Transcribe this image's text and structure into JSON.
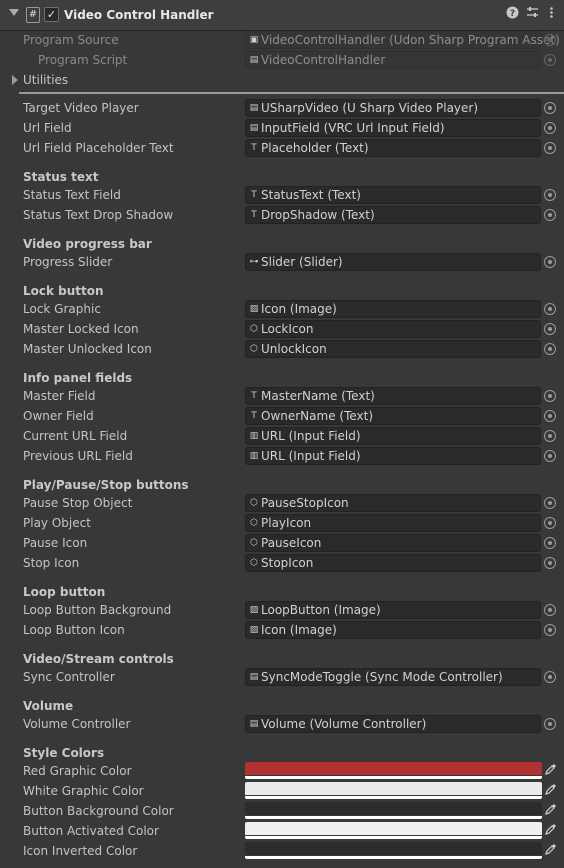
{
  "header": {
    "title": "Video Control Handler",
    "script_glyph": "#",
    "enabled_glyph": "✓",
    "help_icon": "help-icon",
    "settings_icon": "sliders-icon",
    "menu_icon": "kebab-menu-icon"
  },
  "program": {
    "source_label": "Program Source",
    "source_value": "VideoControlHandler (Udon Sharp Program Asset)",
    "script_label": "Program Script",
    "script_value": "VideoControlHandler"
  },
  "utilities_label": "Utilities",
  "fields": {
    "target_video_player": {
      "label": "Target Video Player",
      "value": "USharpVideo (U Sharp Video Player)"
    },
    "url_field": {
      "label": "Url Field",
      "value": "InputField (VRC Url Input Field)"
    },
    "url_placeholder": {
      "label": "Url Field Placeholder Text",
      "value": "Placeholder (Text)"
    },
    "status_text": {
      "label": "Status Text Field",
      "value": "StatusText (Text)"
    },
    "status_shadow": {
      "label": "Status Text Drop Shadow",
      "value": "DropShadow (Text)"
    },
    "progress_slider": {
      "label": "Progress Slider",
      "value": "Slider (Slider)"
    },
    "lock_graphic": {
      "label": "Lock Graphic",
      "value": "Icon (Image)"
    },
    "master_locked_icon": {
      "label": "Master Locked Icon",
      "value": "LockIcon"
    },
    "master_unlocked_icon": {
      "label": "Master Unlocked Icon",
      "value": "UnlockIcon"
    },
    "master_field": {
      "label": "Master Field",
      "value": "MasterName (Text)"
    },
    "owner_field": {
      "label": "Owner Field",
      "value": "OwnerName (Text)"
    },
    "current_url_field": {
      "label": "Current URL Field",
      "value": "URL (Input Field)"
    },
    "previous_url_field": {
      "label": "Previous URL Field",
      "value": "URL (Input Field)"
    },
    "pause_stop_object": {
      "label": "Pause Stop Object",
      "value": "PauseStopIcon"
    },
    "play_object": {
      "label": "Play Object",
      "value": "PlayIcon"
    },
    "pause_icon": {
      "label": "Pause Icon",
      "value": "PauseIcon"
    },
    "stop_icon": {
      "label": "Stop Icon",
      "value": "StopIcon"
    },
    "loop_button_bg": {
      "label": "Loop Button Background",
      "value": "LoopButton (Image)"
    },
    "loop_button_icon": {
      "label": "Loop Button Icon",
      "value": "Icon (Image)"
    },
    "sync_controller": {
      "label": "Sync Controller",
      "value": "SyncModeToggle (Sync Mode Controller)"
    },
    "volume_controller": {
      "label": "Volume Controller",
      "value": "Volume (Volume Controller)"
    }
  },
  "sections": {
    "status_text": "Status text",
    "progress_bar": "Video progress bar",
    "lock_button": "Lock button",
    "info_panel": "Info panel fields",
    "play_pause_stop": "Play/Pause/Stop buttons",
    "loop_button": "Loop button",
    "video_stream": "Video/Stream controls",
    "volume": "Volume",
    "style_colors": "Style Colors"
  },
  "colors": {
    "red_graphic": {
      "label": "Red Graphic Color",
      "color": "#b03232"
    },
    "white_graphic": {
      "label": "White Graphic Color",
      "color": "#ebebeb"
    },
    "button_background": {
      "label": "Button Background Color",
      "color": "#2c2c2c"
    },
    "button_activated": {
      "label": "Button Activated Color",
      "color": "#efefef"
    },
    "icon_inverted": {
      "label": "Icon Inverted Color",
      "color": "#2c2c2c"
    }
  },
  "icons": {
    "object_picker": "object-picker-icon",
    "eyedropper": "eyedropper-icon"
  }
}
